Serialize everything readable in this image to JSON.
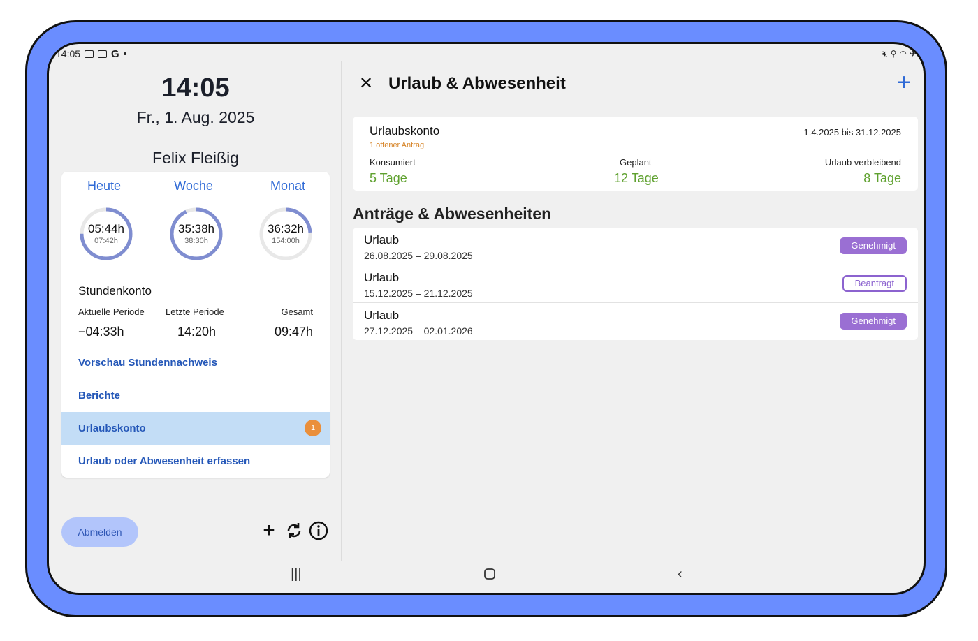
{
  "status": {
    "time": "14:05",
    "g": "G"
  },
  "left": {
    "clock": "14:05",
    "date": "Fr., 1. Aug. 2025",
    "user": "Felix Fleißig",
    "tabs": [
      {
        "label": "Heute",
        "worked": "05:44h",
        "target": "07:42h",
        "progress": 0.75
      },
      {
        "label": "Woche",
        "worked": "35:38h",
        "target": "38:30h",
        "progress": 0.93
      },
      {
        "label": "Monat",
        "worked": "36:32h",
        "target": "154:00h",
        "progress": 0.24
      }
    ],
    "stundenkonto": {
      "title": "Stundenkonto",
      "headers": [
        "Aktuelle Periode",
        "Letzte Periode",
        "Gesamt"
      ],
      "values": [
        "−04:33h",
        "14:20h",
        "09:47h"
      ]
    },
    "links": [
      "Vorschau Stundennachweis",
      "Berichte",
      "Urlaubskonto",
      "Urlaub oder Abwesenheit erfassen"
    ],
    "urlaubskonto_badge": "1",
    "logout": "Abmelden",
    "icons": [
      "plus-icon",
      "sync-icon",
      "info-icon"
    ]
  },
  "right": {
    "title": "Urlaub & Abwesenheit",
    "konto": {
      "title": "Urlaubskonto",
      "open": "1 offener Antrag",
      "range": "1.4.2025 bis 31.12.2025",
      "headers": [
        "Konsumiert",
        "Geplant",
        "Urlaub verbleibend"
      ],
      "values": [
        "5 Tage",
        "12 Tage",
        "8 Tage"
      ]
    },
    "section": "Anträge & Abwesenheiten",
    "items": [
      {
        "type": "Urlaub",
        "dates": "26.08.2025 – 29.08.2025",
        "status": "Genehmigt"
      },
      {
        "type": "Urlaub",
        "dates": "15.12.2025 – 21.12.2025",
        "status": "Beantragt"
      },
      {
        "type": "Urlaub",
        "dates": "27.12.2025 – 02.01.2026",
        "status": "Genehmigt"
      }
    ]
  },
  "colors": {
    "accent": "#2f6ad6",
    "ring": "#7f8dd0",
    "approved": "#9a6fd3",
    "positive": "#5fa12f",
    "badge": "#ea8f3b"
  }
}
